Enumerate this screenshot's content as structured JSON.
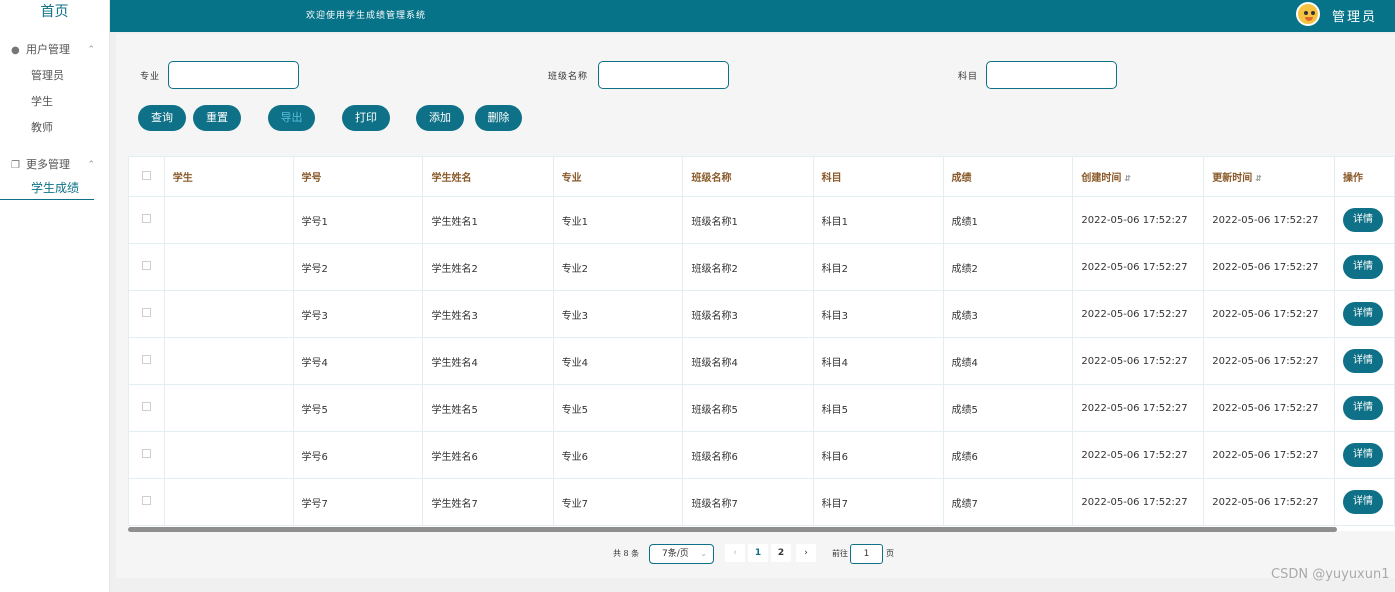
{
  "sidebar": {
    "home": "首页",
    "groups": [
      {
        "label": "用户管理",
        "icon": "user-icon",
        "items": [
          "管理员",
          "学生",
          "教师"
        ]
      },
      {
        "label": "更多管理",
        "icon": "copy-icon",
        "items": [
          "学生成绩"
        ]
      }
    ]
  },
  "topbar": {
    "welcome": "欢迎使用学生成绩管理系统",
    "admin_label": "管理员"
  },
  "filters": {
    "major_label": "专业",
    "class_label": "班级名称",
    "subject_label": "科目"
  },
  "buttons": {
    "query": "查询",
    "reset": "重置",
    "export": "导出",
    "print": "打印",
    "add": "添加",
    "delete": "删除"
  },
  "table": {
    "headers": [
      "学生",
      "学号",
      "学生姓名",
      "专业",
      "班级名称",
      "科目",
      "成绩",
      "创建时间",
      "更新时间",
      "操作"
    ],
    "rows": [
      [
        "",
        "学号1",
        "学生姓名1",
        "专业1",
        "班级名称1",
        "科目1",
        "成绩1",
        "2022-05-06 17:52:27",
        "2022-05-06 17:52:27"
      ],
      [
        "",
        "学号2",
        "学生姓名2",
        "专业2",
        "班级名称2",
        "科目2",
        "成绩2",
        "2022-05-06 17:52:27",
        "2022-05-06 17:52:27"
      ],
      [
        "",
        "学号3",
        "学生姓名3",
        "专业3",
        "班级名称3",
        "科目3",
        "成绩3",
        "2022-05-06 17:52:27",
        "2022-05-06 17:52:27"
      ],
      [
        "",
        "学号4",
        "学生姓名4",
        "专业4",
        "班级名称4",
        "科目4",
        "成绩4",
        "2022-05-06 17:52:27",
        "2022-05-06 17:52:27"
      ],
      [
        "",
        "学号5",
        "学生姓名5",
        "专业5",
        "班级名称5",
        "科目5",
        "成绩5",
        "2022-05-06 17:52:27",
        "2022-05-06 17:52:27"
      ],
      [
        "",
        "学号6",
        "学生姓名6",
        "专业6",
        "班级名称6",
        "科目6",
        "成绩6",
        "2022-05-06 17:52:27",
        "2022-05-06 17:52:27"
      ],
      [
        "",
        "学号7",
        "学生姓名7",
        "专业7",
        "班级名称7",
        "科目7",
        "成绩7",
        "2022-05-06 17:52:27",
        "2022-05-06 17:52:27"
      ]
    ],
    "detail_label": "详情"
  },
  "pagination": {
    "total": "共 8 条",
    "page_size": "7条/页",
    "pages": [
      "1",
      "2"
    ],
    "current_page": "1",
    "goto_label": "前往",
    "goto_value": "1",
    "page_suffix": "页"
  },
  "watermark": "CSDN @yuyuxun1",
  "colors": {
    "primary": "#0e7187",
    "topbar": "#077388",
    "header_text": "#8a5a2a"
  }
}
